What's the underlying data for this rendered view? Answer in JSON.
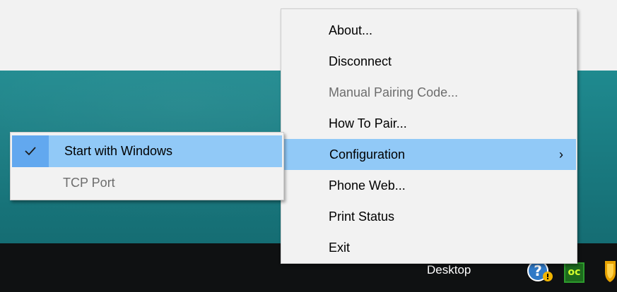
{
  "main_menu": {
    "items": [
      {
        "label": "About...",
        "disabled": false
      },
      {
        "label": "Disconnect",
        "disabled": false
      },
      {
        "label": "Manual Pairing Code...",
        "disabled": true
      },
      {
        "label": "How To Pair...",
        "disabled": false
      },
      {
        "label": "Configuration",
        "disabled": false,
        "highlighted": true,
        "submenu_arrow": "›"
      },
      {
        "label": "Phone Web...",
        "disabled": false
      },
      {
        "label": "Print Status",
        "disabled": false
      },
      {
        "label": "Exit",
        "disabled": false
      }
    ]
  },
  "sub_menu": {
    "items": [
      {
        "label": "Start with Windows",
        "checked": true,
        "highlighted": true,
        "icon": "checkmark-icon"
      },
      {
        "label": "TCP Port",
        "disabled": true
      }
    ]
  },
  "taskbar": {
    "label": "Desktop",
    "tray_icons": [
      "help-icon",
      "oc-app-icon",
      "shield-icon"
    ],
    "oc_text": "oc"
  },
  "colors": {
    "highlight": "#91c9f7",
    "check_background": "#62a8ef",
    "menu_background": "#f2f2f2",
    "disabled_text": "#6d6d6d",
    "desktop_teal": "#1a7c82",
    "taskbar": "#0f1112"
  }
}
